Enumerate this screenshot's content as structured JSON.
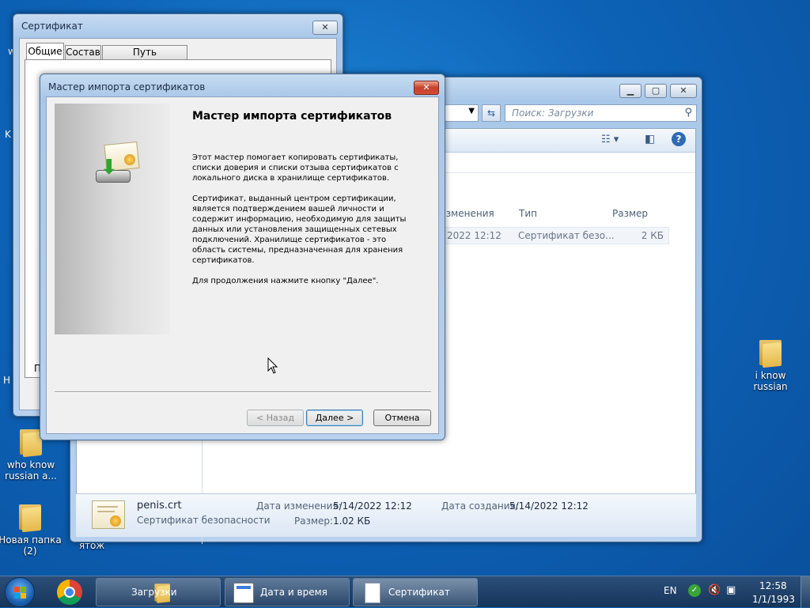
{
  "desktop": {
    "icons": [
      {
        "label": "who know russian a..."
      },
      {
        "label": "Новая папка (2)"
      },
      {
        "label": "ятож"
      },
      {
        "label": "i know russian"
      }
    ],
    "edge_glyphs": {
      "w": "w",
      "k": "K",
      "h": "H"
    }
  },
  "cert_window": {
    "title": "Сертификат",
    "tabs": [
      "Общие",
      "Состав",
      "Путь сертификации"
    ],
    "partial_label": "П"
  },
  "explorer": {
    "search_placeholder": "Поиск: Загрузки",
    "columns": [
      "изменения",
      "Тип",
      "Размер"
    ],
    "file": {
      "date": "2022 12:12",
      "type": "Сертификат безо...",
      "size": "2 КБ"
    },
    "details": {
      "name": "penis.crt",
      "kind": "Сертификат безопасности",
      "modified_label": "Дата изменения:",
      "modified_value": "5/14/2022 12:12",
      "created_label": "Дата создания:",
      "created_value": "5/14/2022 12:12",
      "size_label": "Размер:",
      "size_value": "1.02 КБ"
    }
  },
  "wizard": {
    "title": "Мастер импорта сертификатов",
    "heading": "Мастер импорта сертификатов",
    "para1": "Этот мастер помогает копировать сертификаты, списки доверия и списки отзыва сертификатов с локального диска в хранилище сертификатов.",
    "para2": "Сертификат, выданный центром сертификации, является подтверждением вашей личности и содержит информацию, необходимую для защиты данных или установления защищенных сетевых подключений. Хранилище сертификатов - это область системы, предназначенная для хранения сертификатов.",
    "para3": "Для продолжения нажмите кнопку \"Далее\".",
    "back": "< Назад",
    "next": "Далее >",
    "cancel": "Отмена"
  },
  "taskbar": {
    "items": [
      "Загрузки",
      "Дата и время",
      "Сертификат"
    ],
    "lang": "EN",
    "time": "12:58",
    "date": "1/1/1993"
  }
}
